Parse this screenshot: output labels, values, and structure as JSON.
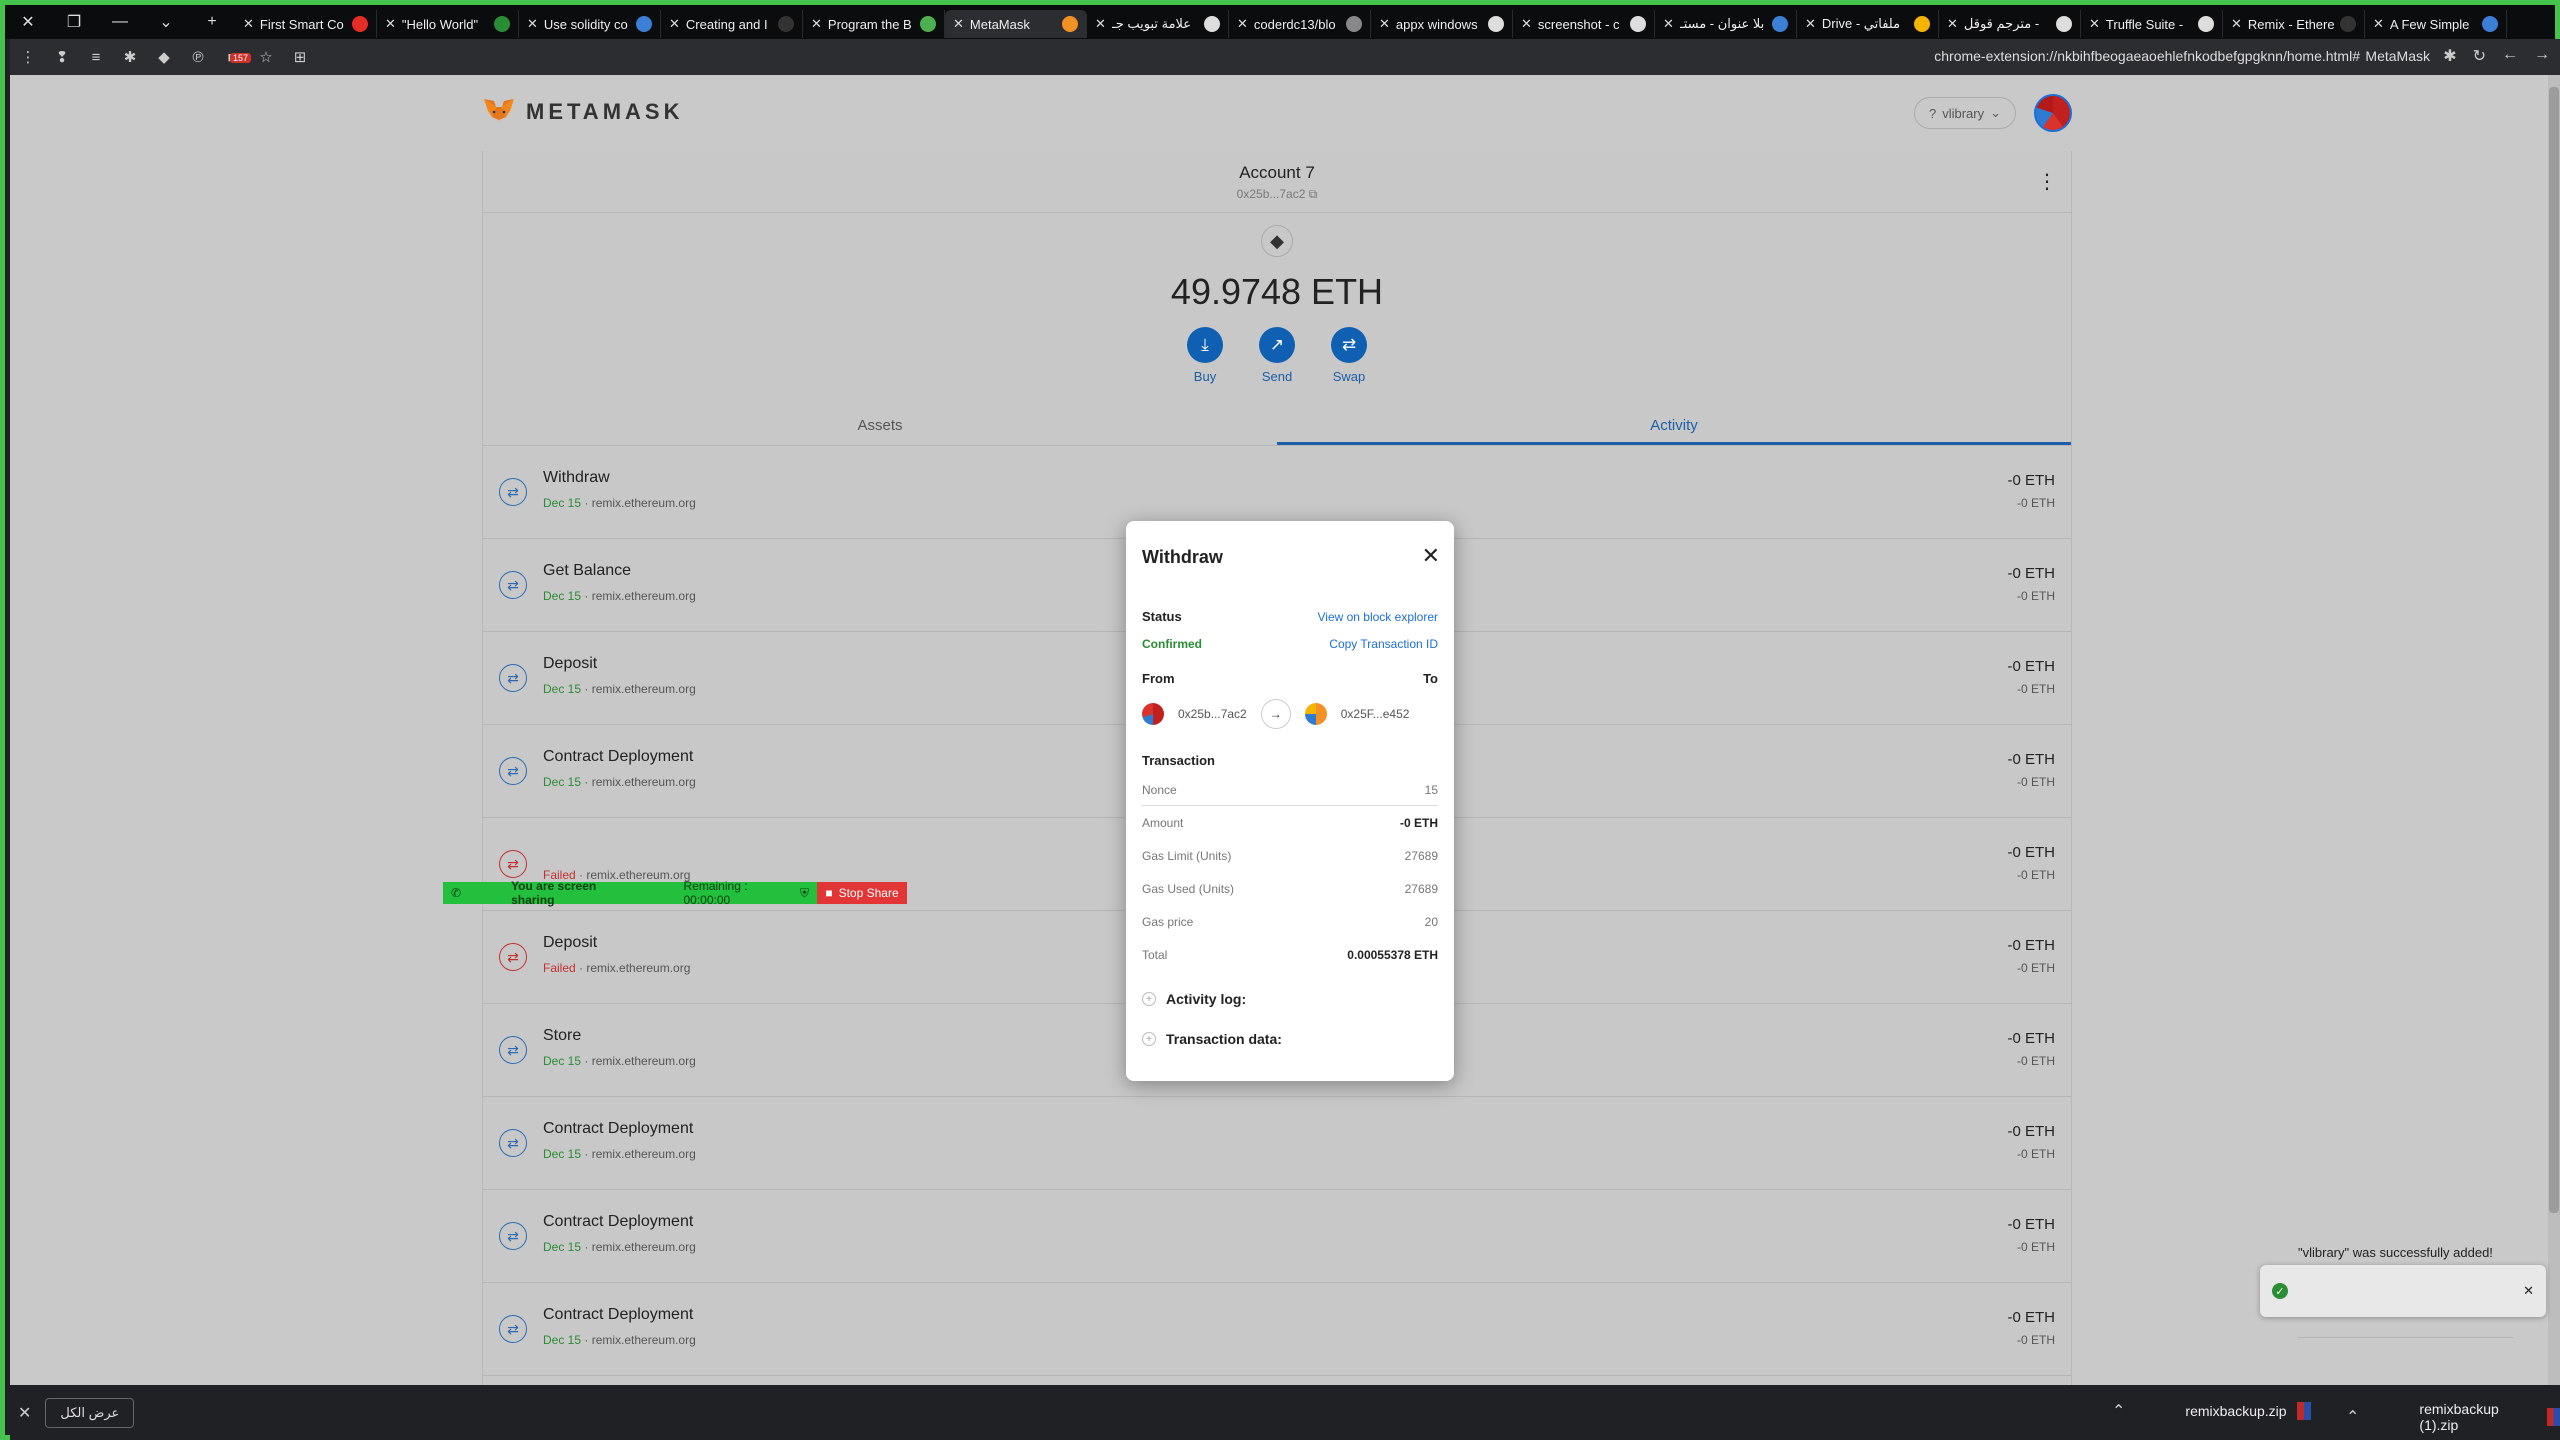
{
  "browser": {
    "tabs": [
      {
        "title": "First Smart Co",
        "fav": "#e52d27"
      },
      {
        "title": "\"Hello World\"",
        "fav": "#2a8c33"
      },
      {
        "title": "Use solidity co",
        "fav": "#3b7fd6"
      },
      {
        "title": "Creating and I",
        "fav": "#333"
      },
      {
        "title": "Program the B",
        "fav": "#4caf50"
      },
      {
        "title": "MetaMask",
        "fav": "#f29125"
      },
      {
        "title": "علامة تبويب جـ",
        "fav": "#ddd"
      },
      {
        "title": "coderdc13/blo",
        "fav": "#888"
      },
      {
        "title": "appx windows",
        "fav": "#ddd"
      },
      {
        "title": "screenshot - c",
        "fav": "#ddd"
      },
      {
        "title": "بلا عنوان - مستـ",
        "fav": "#3b7fd6"
      },
      {
        "title": "Drive - ملفاتي",
        "fav": "#f4b400"
      },
      {
        "title": "مترجم قوقل -",
        "fav": "#ddd"
      },
      {
        "title": "Truffle Suite - ",
        "fav": "#ddd"
      },
      {
        "title": "Remix - Ethere",
        "fav": "#333"
      },
      {
        "title": "A Few Simple",
        "fav": "#3b7fd6"
      }
    ],
    "active_tab": 5,
    "url": "chrome-extension://nkbihfbeogaeaoehlefnkodbefgpgknn/home.html#",
    "ext_title": "MetaMask",
    "badge": "157"
  },
  "metamask": {
    "brand": "METAMASK",
    "network": "vlibrary",
    "account_name": "Account 7",
    "account_addr": "0x25b...7ac2",
    "balance": "49.9748 ETH",
    "actions": {
      "buy": "Buy",
      "send": "Send",
      "swap": "Swap"
    },
    "tabs": {
      "assets": "Assets",
      "activity": "Activity"
    },
    "transactions": [
      {
        "title": "Withdraw",
        "status": "Dec 15",
        "failed": false,
        "origin": "remix.ethereum.org",
        "amount": "-0 ETH",
        "amount2": "-0 ETH"
      },
      {
        "title": "Get Balance",
        "status": "Dec 15",
        "failed": false,
        "origin": "remix.ethereum.org",
        "amount": "-0 ETH",
        "amount2": "-0 ETH"
      },
      {
        "title": "Deposit",
        "status": "Dec 15",
        "failed": false,
        "origin": "remix.ethereum.org",
        "amount": "-0 ETH",
        "amount2": "-0 ETH"
      },
      {
        "title": "Contract Deployment",
        "status": "Dec 15",
        "failed": false,
        "origin": "remix.ethereum.org",
        "amount": "-0 ETH",
        "amount2": "-0 ETH"
      },
      {
        "title": "",
        "status": "Failed",
        "failed": true,
        "origin": "remix.ethereum.org",
        "amount": "-0 ETH",
        "amount2": "-0 ETH"
      },
      {
        "title": "Deposit",
        "status": "Failed",
        "failed": true,
        "origin": "remix.ethereum.org",
        "amount": "-0 ETH",
        "amount2": "-0 ETH"
      },
      {
        "title": "Store",
        "status": "Dec 15",
        "failed": false,
        "origin": "remix.ethereum.org",
        "amount": "-0 ETH",
        "amount2": "-0 ETH"
      },
      {
        "title": "Contract Deployment",
        "status": "Dec 15",
        "failed": false,
        "origin": "remix.ethereum.org",
        "amount": "-0 ETH",
        "amount2": "-0 ETH"
      },
      {
        "title": "Contract Deployment",
        "status": "Dec 15",
        "failed": false,
        "origin": "remix.ethereum.org",
        "amount": "-0 ETH",
        "amount2": "-0 ETH"
      },
      {
        "title": "Contract Deployment",
        "status": "Dec 15",
        "failed": false,
        "origin": "remix.ethereum.org",
        "amount": "-0 ETH",
        "amount2": "-0 ETH"
      }
    ]
  },
  "modal": {
    "title": "Withdraw",
    "status_label": "Status",
    "view_explorer": "View on block explorer",
    "status_value": "Confirmed",
    "copy_tx": "Copy Transaction ID",
    "from_label": "From",
    "to_label": "To",
    "from_addr": "0x25b...7ac2",
    "to_addr": "0x25F...e452",
    "tx_label": "Transaction",
    "nonce_label": "Nonce",
    "nonce": "15",
    "amount_label": "Amount",
    "amount": "-0 ETH",
    "gas_limit_label": "Gas Limit (Units)",
    "gas_limit": "27689",
    "gas_used_label": "Gas Used (Units)",
    "gas_used": "27689",
    "gas_price_label": "Gas price",
    "gas_price": "20",
    "total_label": "Total",
    "total": "0.00055378 ETH",
    "activity_log": "Activity log:",
    "tx_data": "Transaction data:"
  },
  "share": {
    "text": "You are screen sharing",
    "remaining": "Remaining : 00:00:00",
    "stop": "Stop Share"
  },
  "toast": {
    "text": "\"vlibrary\" was successfully added!"
  },
  "downloads": {
    "show_all": "عرض الكل",
    "items": [
      "remixbackup.zip",
      "remixbackup (1).zip"
    ]
  }
}
